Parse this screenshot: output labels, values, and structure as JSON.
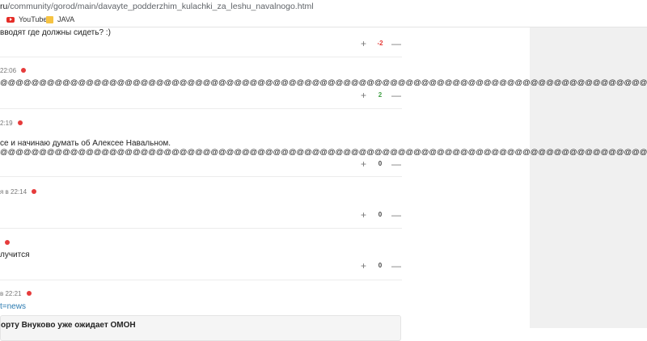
{
  "browser": {
    "url_prefix": "ru",
    "url_rest": "/community/gorod/main/davayte_podderzhim_kulachki_za_leshu_navalnogo.html",
    "bookmarks": [
      "YouTube",
      "JAVA"
    ]
  },
  "comments": [
    {
      "meta": "",
      "text": "вводят где должны сидеть? :)",
      "score": "-2",
      "score_color": "#e53935"
    },
    {
      "meta": "22:06",
      "text": "@@@@@@@@@@@@@@@@@@@@@@@@@@@@@@@@@@@@@@@@@@@@@@@@@@@@@@@@@@@@@@@@@@@@@@@@@@@@@@@@@@@@@",
      "score": "2",
      "score_color": "#43a047"
    },
    {
      "meta": "2:19",
      "text": "се и начинаю думать об Алексее Навальном.",
      "text2": "@@@@@@@@@@@@@@@@@@@@@@@@@@@@@@@@@@@@@@@@@@@@@@@@@@@@@@@@@@@@@@@@@@@@@@@@@@@@@@@@@@@@@@@@@@@@@@@@@@@@@@@@@@@@@@@@@@@@@@@@@@@@@",
      "score": "0",
      "score_color": "#444444"
    },
    {
      "meta": "я в 22:14",
      "text": "",
      "score": "0",
      "score_color": "#444444"
    },
    {
      "meta": "",
      "text": "лучится",
      "score": "0",
      "score_color": "#444444"
    },
    {
      "meta": "в 22:21",
      "link": "t=news"
    }
  ],
  "vote": {
    "plus": "+",
    "minus": "—"
  },
  "card_title": "орту Внуково уже ожидает ОМОН"
}
